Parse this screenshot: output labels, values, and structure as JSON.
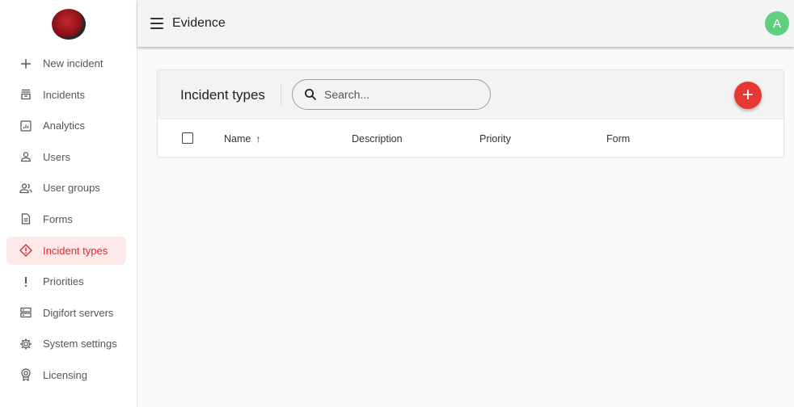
{
  "topbar": {
    "title": "Evidence",
    "avatar_letter": "A",
    "avatar_color": "#5fd07d"
  },
  "sidebar": {
    "items": [
      {
        "label": "New incident",
        "icon": "plus-icon",
        "active": false
      },
      {
        "label": "Incidents",
        "icon": "inbox-icon",
        "active": false
      },
      {
        "label": "Analytics",
        "icon": "analytics-icon",
        "active": false
      },
      {
        "label": "Users",
        "icon": "user-icon",
        "active": false
      },
      {
        "label": "User groups",
        "icon": "user-group-icon",
        "active": false
      },
      {
        "label": "Forms",
        "icon": "document-icon",
        "active": false
      },
      {
        "label": "Incident types",
        "icon": "warning-diamond-icon",
        "active": true
      },
      {
        "label": "Priorities",
        "icon": "exclamation-icon",
        "active": false
      },
      {
        "label": "Digifort servers",
        "icon": "server-icon",
        "active": false
      },
      {
        "label": "System settings",
        "icon": "gear-icon",
        "active": false
      },
      {
        "label": "Licensing",
        "icon": "badge-icon",
        "active": false
      }
    ]
  },
  "panel": {
    "title": "Incident types",
    "search_placeholder": "Search...",
    "add_button_label": "+",
    "columns": {
      "name": "Name",
      "sort_arrow": "↑",
      "description": "Description",
      "priority": "Priority",
      "form": "Form"
    }
  },
  "colors": {
    "accent": "#d32f2f",
    "active_bg": "#fde9ea",
    "add_button": "#e53935"
  }
}
